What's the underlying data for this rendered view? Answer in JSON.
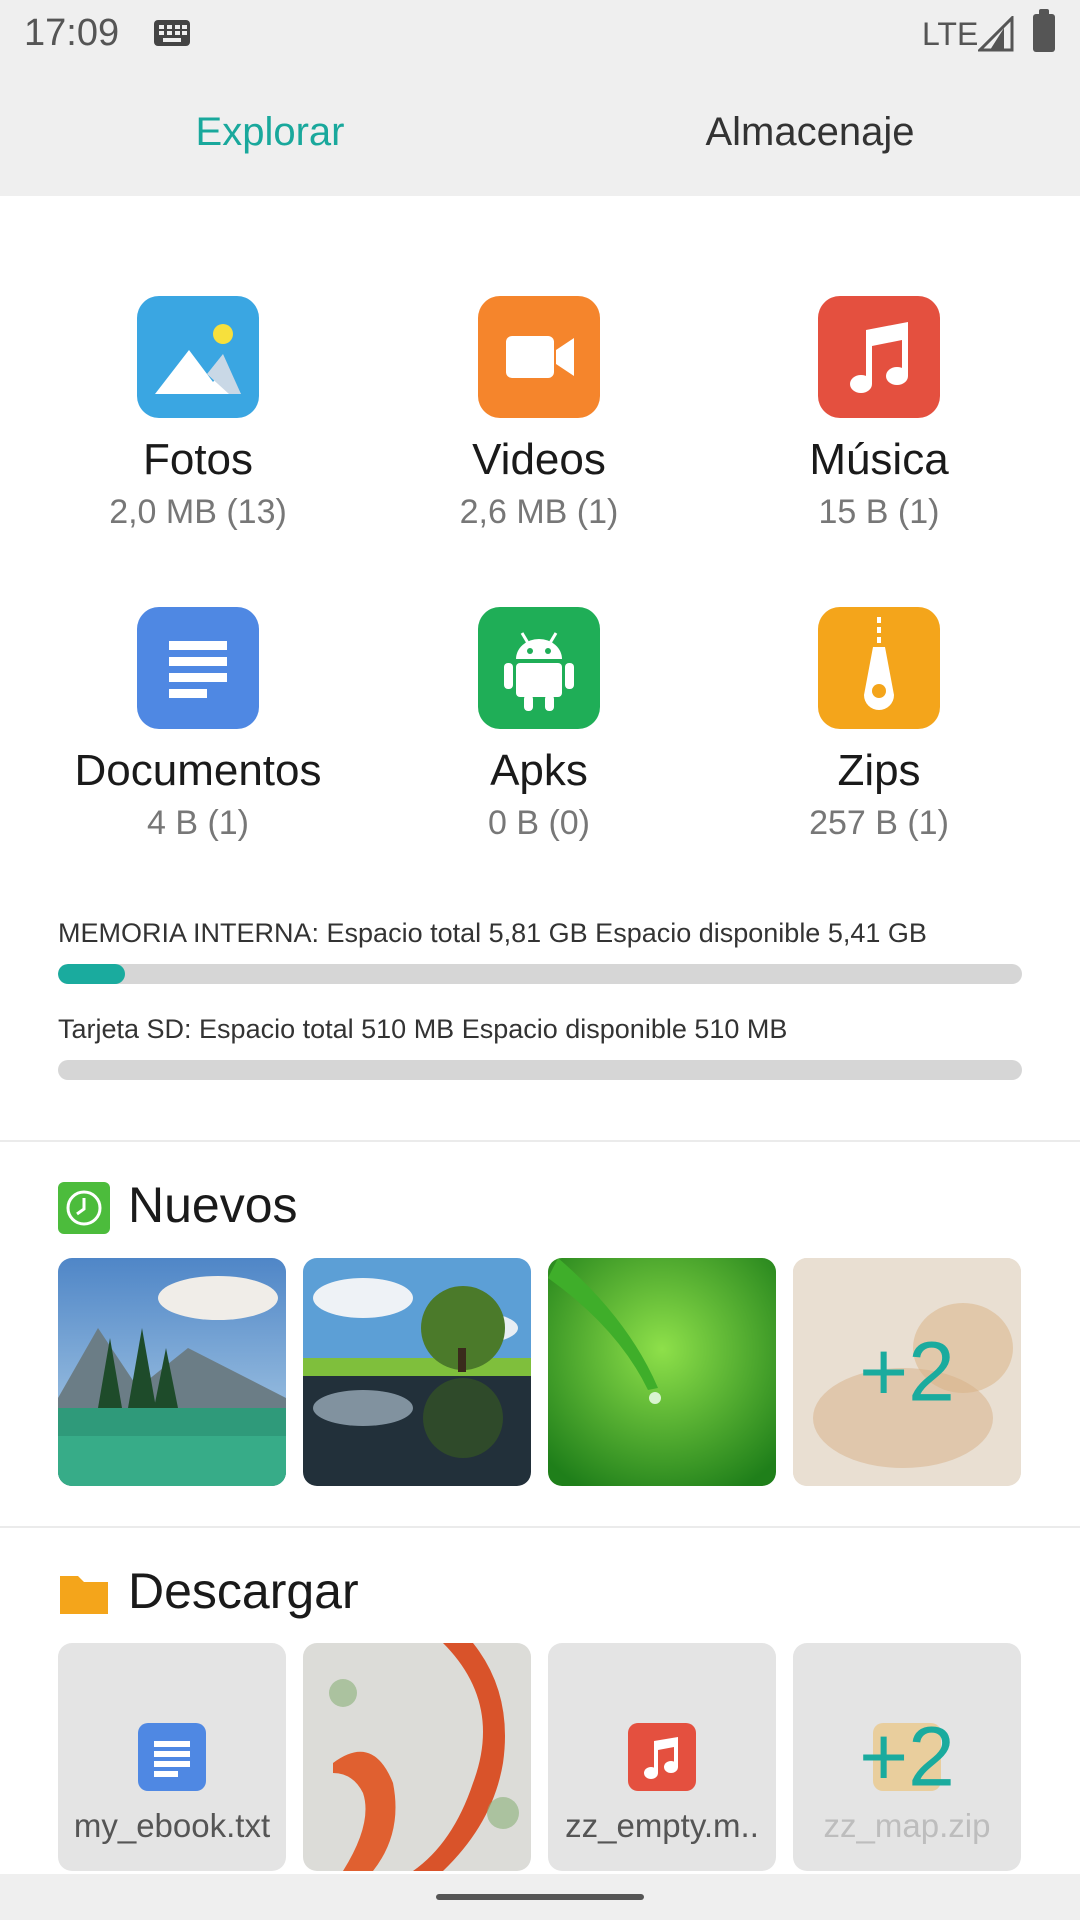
{
  "status_bar": {
    "time": "17:09",
    "network": "LTE"
  },
  "tabs": [
    {
      "label": "Explorar",
      "active": true
    },
    {
      "label": "Almacenaje",
      "active": false
    }
  ],
  "categories": [
    {
      "name": "Fotos",
      "size": "2,0 MB (13)",
      "icon": "image-icon",
      "color": "#3aa6e2"
    },
    {
      "name": "Videos",
      "size": "2,6 MB (1)",
      "icon": "video-camera-icon",
      "color": "#f5852c"
    },
    {
      "name": "Música",
      "size": "15 B (1)",
      "icon": "music-note-icon",
      "color": "#e4503f"
    },
    {
      "name": "Documentos",
      "size": "4 B (1)",
      "icon": "document-icon",
      "color": "#4f88e3"
    },
    {
      "name": "Apks",
      "size": "0 B (0)",
      "icon": "android-icon",
      "color": "#1fae57"
    },
    {
      "name": "Zips",
      "size": "257 B (1)",
      "icon": "zip-icon",
      "color": "#f4a51b"
    }
  ],
  "storage": {
    "internal": {
      "label": "MEMORIA INTERNA: Espacio total 5,81 GB  Espacio disponible 5,41 GB",
      "used_fraction": 0.069
    },
    "sd": {
      "label": "Tarjeta SD: Espacio total 510 MB  Espacio disponible 510 MB",
      "used_fraction": 0.0
    }
  },
  "recent": {
    "title": "Nuevos",
    "icon": "clock-icon",
    "more_count": "+2"
  },
  "downloads": {
    "title": "Descargar",
    "icon": "folder-icon",
    "files": [
      {
        "name": "my_ebook.txt",
        "icon": "document-icon"
      },
      {
        "name": "",
        "icon": "image-thumbnail"
      },
      {
        "name": "zz_empty.m..",
        "icon": "music-note-icon"
      },
      {
        "name": "zz_map.zip",
        "icon": "zip-icon"
      }
    ],
    "more_count": "+2"
  },
  "colors": {
    "accent": "#1aab9e",
    "background": "#ffffff",
    "bars": "#efefef"
  }
}
